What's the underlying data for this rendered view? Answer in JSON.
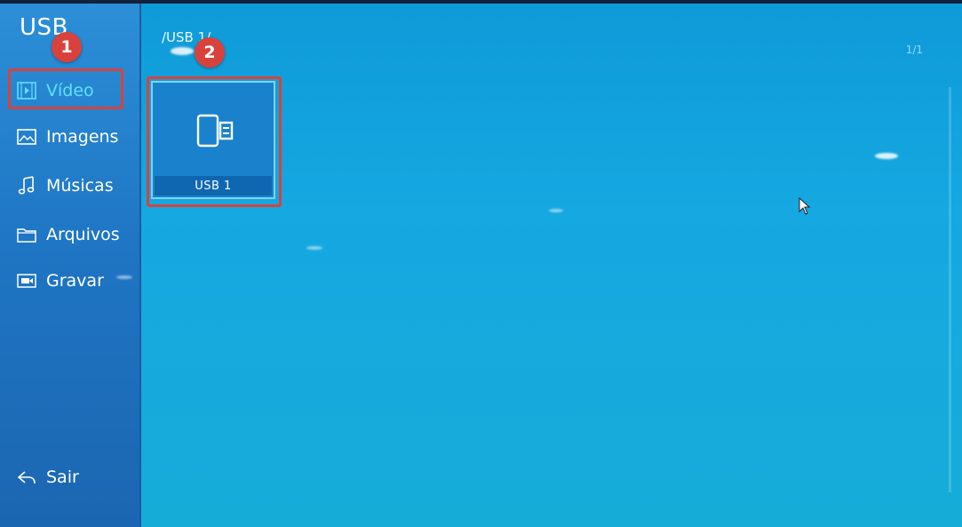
{
  "sidebar": {
    "title": "USB",
    "items": [
      {
        "label": "Vídeo",
        "icon": "video-icon",
        "active": true
      },
      {
        "label": "Imagens",
        "icon": "image-icon",
        "active": false
      },
      {
        "label": "Músicas",
        "icon": "music-note-icon",
        "active": false
      },
      {
        "label": "Arquivos",
        "icon": "folder-icon",
        "active": false
      },
      {
        "label": "Gravar",
        "icon": "record-icon",
        "active": false
      }
    ],
    "exit_label": "Sair",
    "exit_icon": "back-arrow-icon"
  },
  "main": {
    "breadcrumb": "/USB 1/",
    "page_indicator": "1/1",
    "tiles": [
      {
        "label": "USB 1",
        "icon": "usb-drive-icon"
      }
    ]
  },
  "annotations": [
    {
      "number": "1",
      "target": "Vídeo"
    },
    {
      "number": "2",
      "target": "USB 1"
    }
  ],
  "colors": {
    "accent_active": "#5fe0ff",
    "annotation_red": "#d9423c",
    "sidebar_blue": "#1f76c4",
    "main_blue": "#15a8e1"
  }
}
